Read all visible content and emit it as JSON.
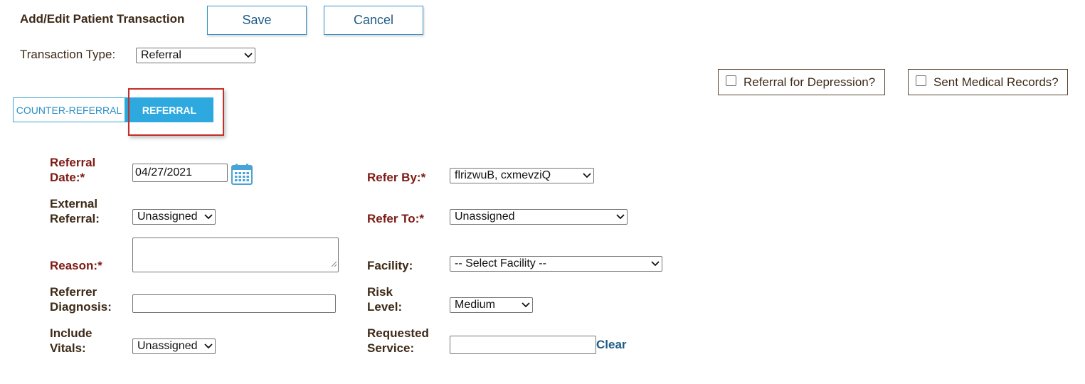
{
  "header": {
    "title": "Add/Edit Patient Transaction",
    "save_label": "Save",
    "cancel_label": "Cancel"
  },
  "transaction_type": {
    "label": "Transaction Type:",
    "value": "Referral"
  },
  "checkboxes": {
    "depression_label": "Referral for Depression?",
    "medical_records_label": "Sent Medical Records?"
  },
  "tabs": [
    {
      "label": "COUNTER-REFERRAL",
      "active": false
    },
    {
      "label": "REFERRAL",
      "active": true
    }
  ],
  "form": {
    "referral_date": {
      "label_line1": "Referral",
      "label_line2": "Date:*",
      "value": "04/27/2021"
    },
    "refer_by": {
      "label": "Refer By:*",
      "value": "flrizwuB, cxmevziQ"
    },
    "external_referral": {
      "label_line1": "External",
      "label_line2": "Referral:",
      "value": "Unassigned"
    },
    "refer_to": {
      "label": "Refer To:*",
      "value": "Unassigned"
    },
    "reason": {
      "label": "Reason:*",
      "value": ""
    },
    "facility": {
      "label": "Facility:",
      "value": "-- Select Facility --"
    },
    "referrer_diagnosis": {
      "label_line1": "Referrer",
      "label_line2": "Diagnosis:",
      "value": ""
    },
    "risk_level": {
      "label_line1": "Risk",
      "label_line2": "Level:",
      "value": "Medium"
    },
    "include_vitals": {
      "label_line1": "Include",
      "label_line2": "Vitals:",
      "value": "Unassigned"
    },
    "requested_service": {
      "label_line1": "Requested",
      "label_line2": "Service:",
      "value": ""
    },
    "clear_label": "Clear"
  },
  "colors": {
    "accent": "#2ea9e0",
    "required_label": "#7d1a14",
    "label": "#3d2a17",
    "button_border": "#3a95c7",
    "highlight": "#c0302a"
  }
}
